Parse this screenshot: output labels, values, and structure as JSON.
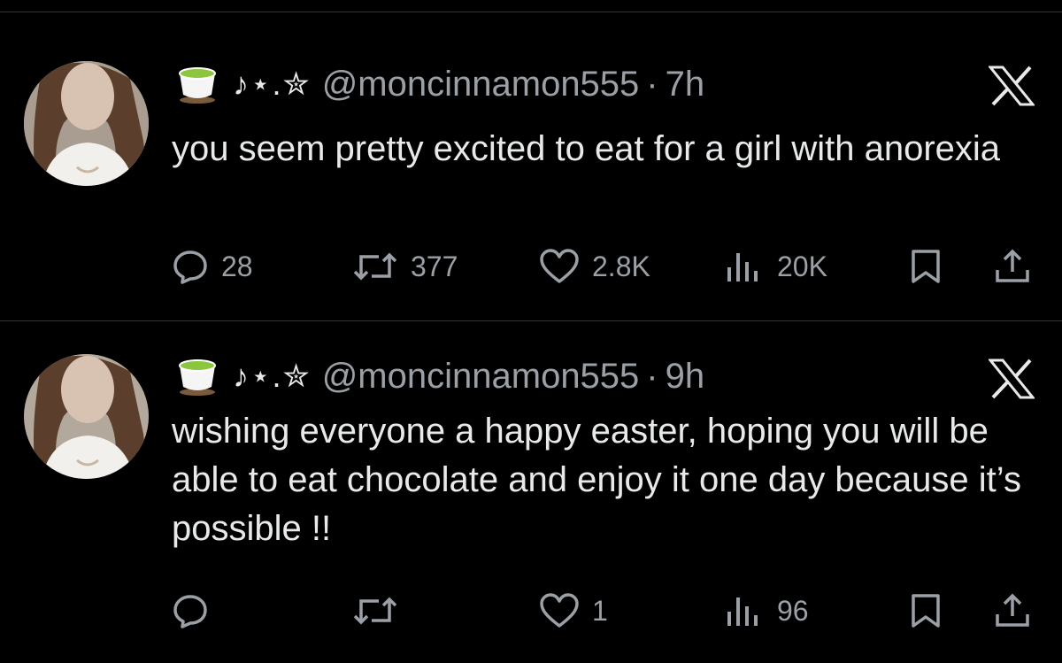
{
  "tweets": [
    {
      "name_decoration": "♪⋆.✮",
      "handle": "@moncinnamon555",
      "separator": "·",
      "time": "7h",
      "text": "you seem pretty excited to eat for a girl with anorexia",
      "replies": "28",
      "reposts": "377",
      "likes": "2.8K",
      "views": "20K"
    },
    {
      "name_decoration": "♪⋆.✮",
      "handle": "@moncinnamon555",
      "separator": "·",
      "time": "9h",
      "text": "wishing everyone a happy easter, hoping you will be able to eat chocolate and enjoy it one day because it’s possible !!",
      "replies": "",
      "reposts": "",
      "likes": "1",
      "views": "96"
    }
  ],
  "icons": {
    "name_emoji": "teacup-icon",
    "reply": "reply-icon",
    "repost": "repost-icon",
    "like": "heart-icon",
    "views": "views-icon",
    "bookmark": "bookmark-icon",
    "share": "share-icon",
    "platform": "x-logo-icon"
  },
  "colors": {
    "background": "#000000",
    "text": "#e7e9ea",
    "muted": "#9aa0a6",
    "divider": "#2f3336"
  }
}
